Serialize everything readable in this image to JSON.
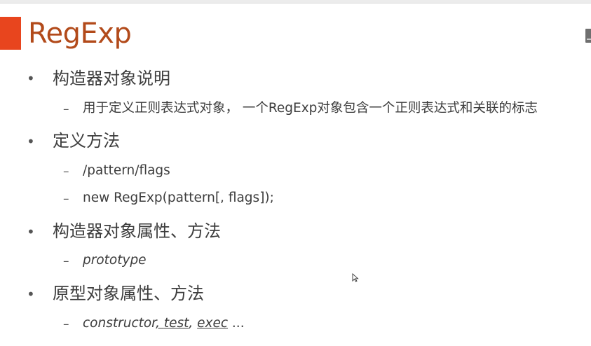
{
  "slide": {
    "title": "RegExp",
    "items": [
      {
        "text": "构造器对象说明",
        "sub": [
          {
            "text": "用于定义正则表达式对象， 一个RegExp对象包含一个正则表达式和关联的标志"
          }
        ]
      },
      {
        "text": "定义方法",
        "sub": [
          {
            "text": "/pattern/flags"
          },
          {
            "text": "new RegExp(pattern[, flags]);"
          }
        ]
      },
      {
        "text": "构造器对象属性、方法",
        "sub": [
          {
            "text": "prototype"
          }
        ]
      },
      {
        "text": "原型对象属性、方法",
        "sub": [
          {
            "parts": [
              "constructor",
              ", ",
              "test",
              ", ",
              "exec",
              " ..."
            ]
          }
        ]
      }
    ],
    "bullet_char": "•",
    "dash_char": "–"
  },
  "colors": {
    "accent": "#e8451e",
    "title": "#b24a1a",
    "text": "#3d3d3d"
  },
  "icons": {
    "bullet": "bullet-dot-icon",
    "dash": "dash-icon",
    "cursor": "mouse-pointer-icon"
  }
}
